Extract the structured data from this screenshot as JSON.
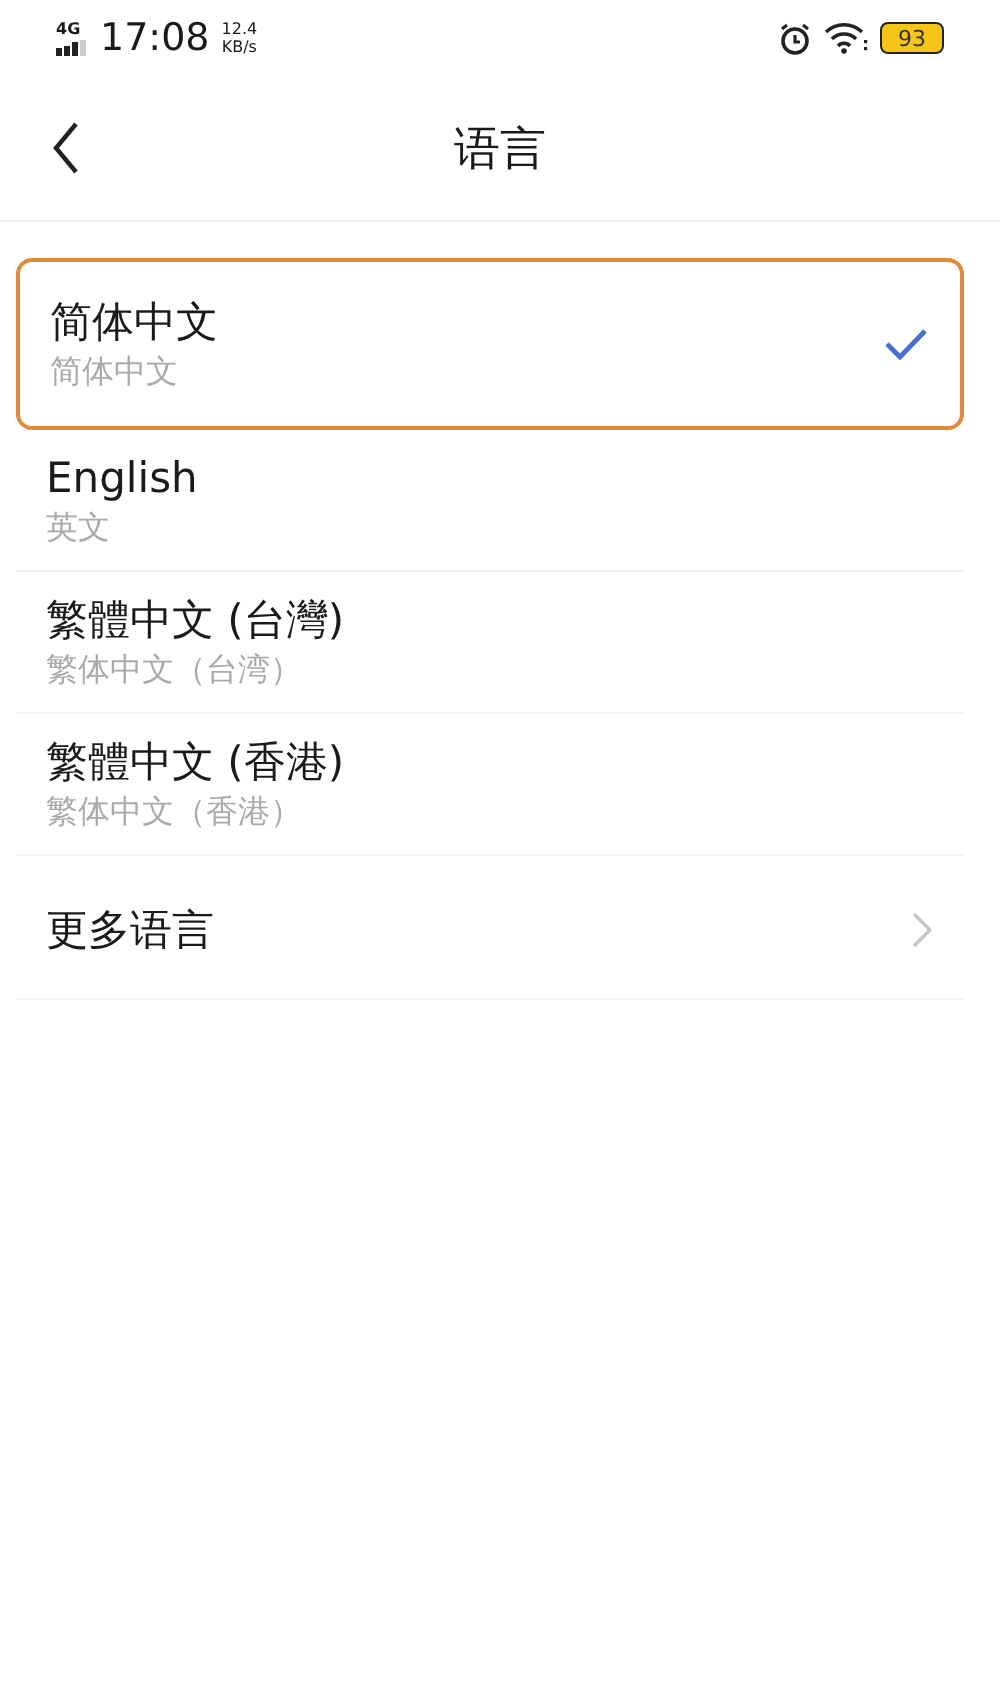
{
  "status_bar": {
    "network": "4G",
    "time": "17:08",
    "speed_value": "12.4",
    "speed_unit": "KB/s",
    "battery": "93"
  },
  "header": {
    "title": "语言"
  },
  "languages": [
    {
      "name": "简体中文",
      "subtitle": "简体中文",
      "selected": true,
      "highlighted": true
    },
    {
      "name": "English",
      "subtitle": "英文",
      "selected": false,
      "highlighted": false
    },
    {
      "name": "繁體中文 (台灣)",
      "subtitle": "繁体中文（台湾）",
      "selected": false,
      "highlighted": false
    },
    {
      "name": "繁體中文 (香港)",
      "subtitle": "繁体中文（香港）",
      "selected": false,
      "highlighted": false
    }
  ],
  "more": {
    "label": "更多语言"
  }
}
